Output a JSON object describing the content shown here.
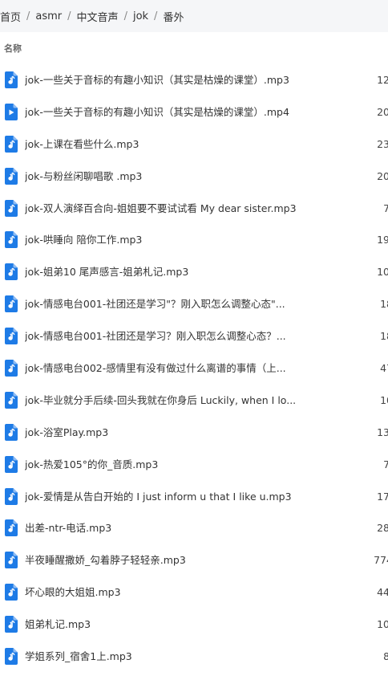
{
  "breadcrumb": [
    "首页",
    "asmr",
    "中文音声",
    "jok",
    "番外"
  ],
  "breadcrumb_separator": "/",
  "list_header": {
    "name": "名称"
  },
  "colors": {
    "icon_blue": "#1e7be6",
    "breadcrumb_bg": "#f5f6f8"
  },
  "files": [
    {
      "name": "jok-一些关于音标的有趣小知识（其实是枯燥的课堂）.mp3",
      "size": "12.",
      "icon": "audio-file-icon"
    },
    {
      "name": "jok-一些关于音标的有趣小知识（其实是枯燥的课堂）.mp4",
      "size": "20.",
      "icon": "video-file-icon"
    },
    {
      "name": "jok-上课在看些什么.mp3",
      "size": "23.",
      "icon": "audio-file-icon"
    },
    {
      "name": "jok-与粉丝闲聊唱歌 .mp3",
      "size": "20.",
      "icon": "audio-file-icon"
    },
    {
      "name": "jok-双人演绎百合向-姐姐要不要试试看 My dear sister.mp3",
      "size": "7.",
      "icon": "audio-file-icon"
    },
    {
      "name": "jok-哄睡向 陪你工作.mp3",
      "size": "19.",
      "icon": "audio-file-icon"
    },
    {
      "name": "jok-姐弟10 尾声感言-姐弟札记.mp3",
      "size": "10.",
      "icon": "audio-file-icon"
    },
    {
      "name": "jok-情感电台001-社团还是学习\"？刚入职怎么调整心态\"...",
      "size": "18",
      "icon": "audio-file-icon"
    },
    {
      "name": "jok-情感电台001-社团还是学习？刚入职怎么调整心态？...",
      "size": "18",
      "icon": "audio-file-icon"
    },
    {
      "name": "jok-情感电台002-感情里有没有做过什么离谱的事情（上...",
      "size": "47",
      "icon": "audio-file-icon"
    },
    {
      "name": "jok-毕业就分手后续-回头我就在你身后 Luckily, when I lo...",
      "size": "10",
      "icon": "audio-file-icon"
    },
    {
      "name": "jok-浴室Play.mp3",
      "size": "13.",
      "icon": "audio-file-icon"
    },
    {
      "name": "jok-热爱105°的你_音质.mp3",
      "size": "7.",
      "icon": "audio-file-icon"
    },
    {
      "name": "jok-爱情是从告白开始的 I just inform u that I like u.mp3",
      "size": "17.",
      "icon": "audio-file-icon"
    },
    {
      "name": "出差-ntr-电话.mp3",
      "size": "28.",
      "icon": "audio-file-icon"
    },
    {
      "name": "半夜睡醒撒娇_勾着脖子轻轻亲.mp3",
      "size": "774",
      "icon": "audio-file-icon"
    },
    {
      "name": "坏心眼的大姐姐.mp3",
      "size": "44.",
      "icon": "audio-file-icon"
    },
    {
      "name": "姐弟札记.mp3",
      "size": "10.",
      "icon": "audio-file-icon"
    },
    {
      "name": "学姐系列_宿舍1上.mp3",
      "size": "8.",
      "icon": "audio-file-icon"
    }
  ]
}
